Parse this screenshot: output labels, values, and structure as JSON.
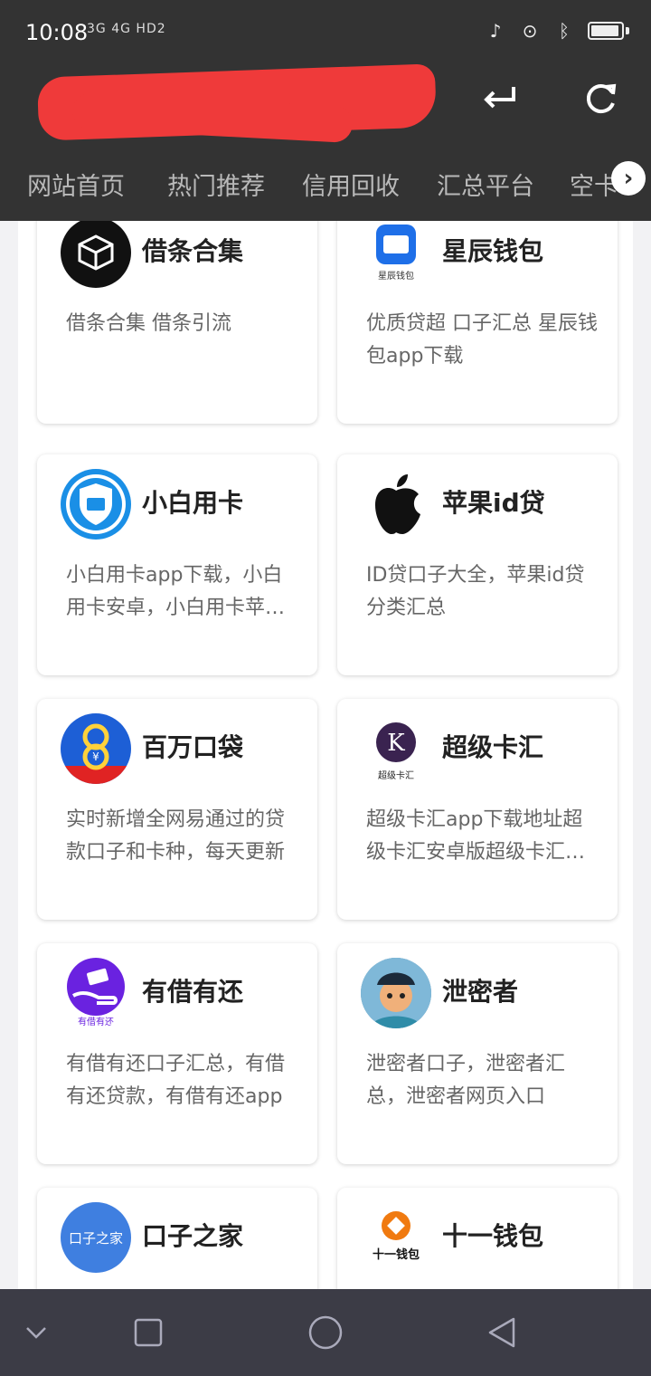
{
  "status": {
    "time": "10:08",
    "signal": "3G 4G HD2"
  },
  "toolbar": {
    "title_redacted": true,
    "back_icon": "enter-arrow-icon",
    "refresh_icon": "refresh-icon"
  },
  "tabs": [
    "网站首页",
    "热门推荐",
    "信用回收",
    "汇总平台",
    "空卡"
  ],
  "cards": [
    {
      "name": "借条合集",
      "desc": "借条合集 借条引流",
      "logo": "box-icon",
      "color": "#111111"
    },
    {
      "name": "星辰钱包",
      "desc": "优质贷超 口子汇总 星辰钱包app下载",
      "logo": "wallet-icon",
      "color": "#1e6fe8",
      "logo_text": "星辰钱包"
    },
    {
      "name": "小白用卡",
      "desc": "小白用卡app下载，小白用卡安卓，小白用卡苹果版",
      "logo": "shield-card-icon",
      "color": "#1a8fe6"
    },
    {
      "name": "苹果id贷",
      "desc": "ID贷口子大全，苹果id贷分类汇总",
      "logo": "apple-icon",
      "color": "#111111"
    },
    {
      "name": "百万口袋",
      "desc": "实时新增全网易通过的贷款口子和卡种，每天更新",
      "logo": "money-bag-icon",
      "color": "#1d5fd6"
    },
    {
      "name": "超级卡汇",
      "desc": "超级卡汇app下载地址超级卡汇安卓版超级卡汇苹果版",
      "logo": "k-badge-icon",
      "color": "#3a2350",
      "logo_text": "超级卡汇"
    },
    {
      "name": "有借有还",
      "desc": "有借有还口子汇总，有借有还贷款，有借有还app",
      "logo": "hand-money-icon",
      "color": "#6a22e0",
      "logo_text": "有借有还"
    },
    {
      "name": "泄密者",
      "desc": "泄密者口子，泄密者汇总，泄密者网页入口",
      "logo": "cartoon-avatar-icon",
      "color": "#3a6f9a"
    },
    {
      "name": "口子之家",
      "desc": "",
      "logo": "text-logo-icon",
      "color": "#3f7fe0",
      "logo_text": "口子之家"
    },
    {
      "name": "十一钱包",
      "desc": "",
      "logo": "orange-diamond-icon",
      "color": "#f07a10",
      "logo_text": "十一钱包"
    }
  ],
  "nav": [
    "chevron-down-icon",
    "square-icon",
    "circle-icon",
    "triangle-back-icon"
  ]
}
